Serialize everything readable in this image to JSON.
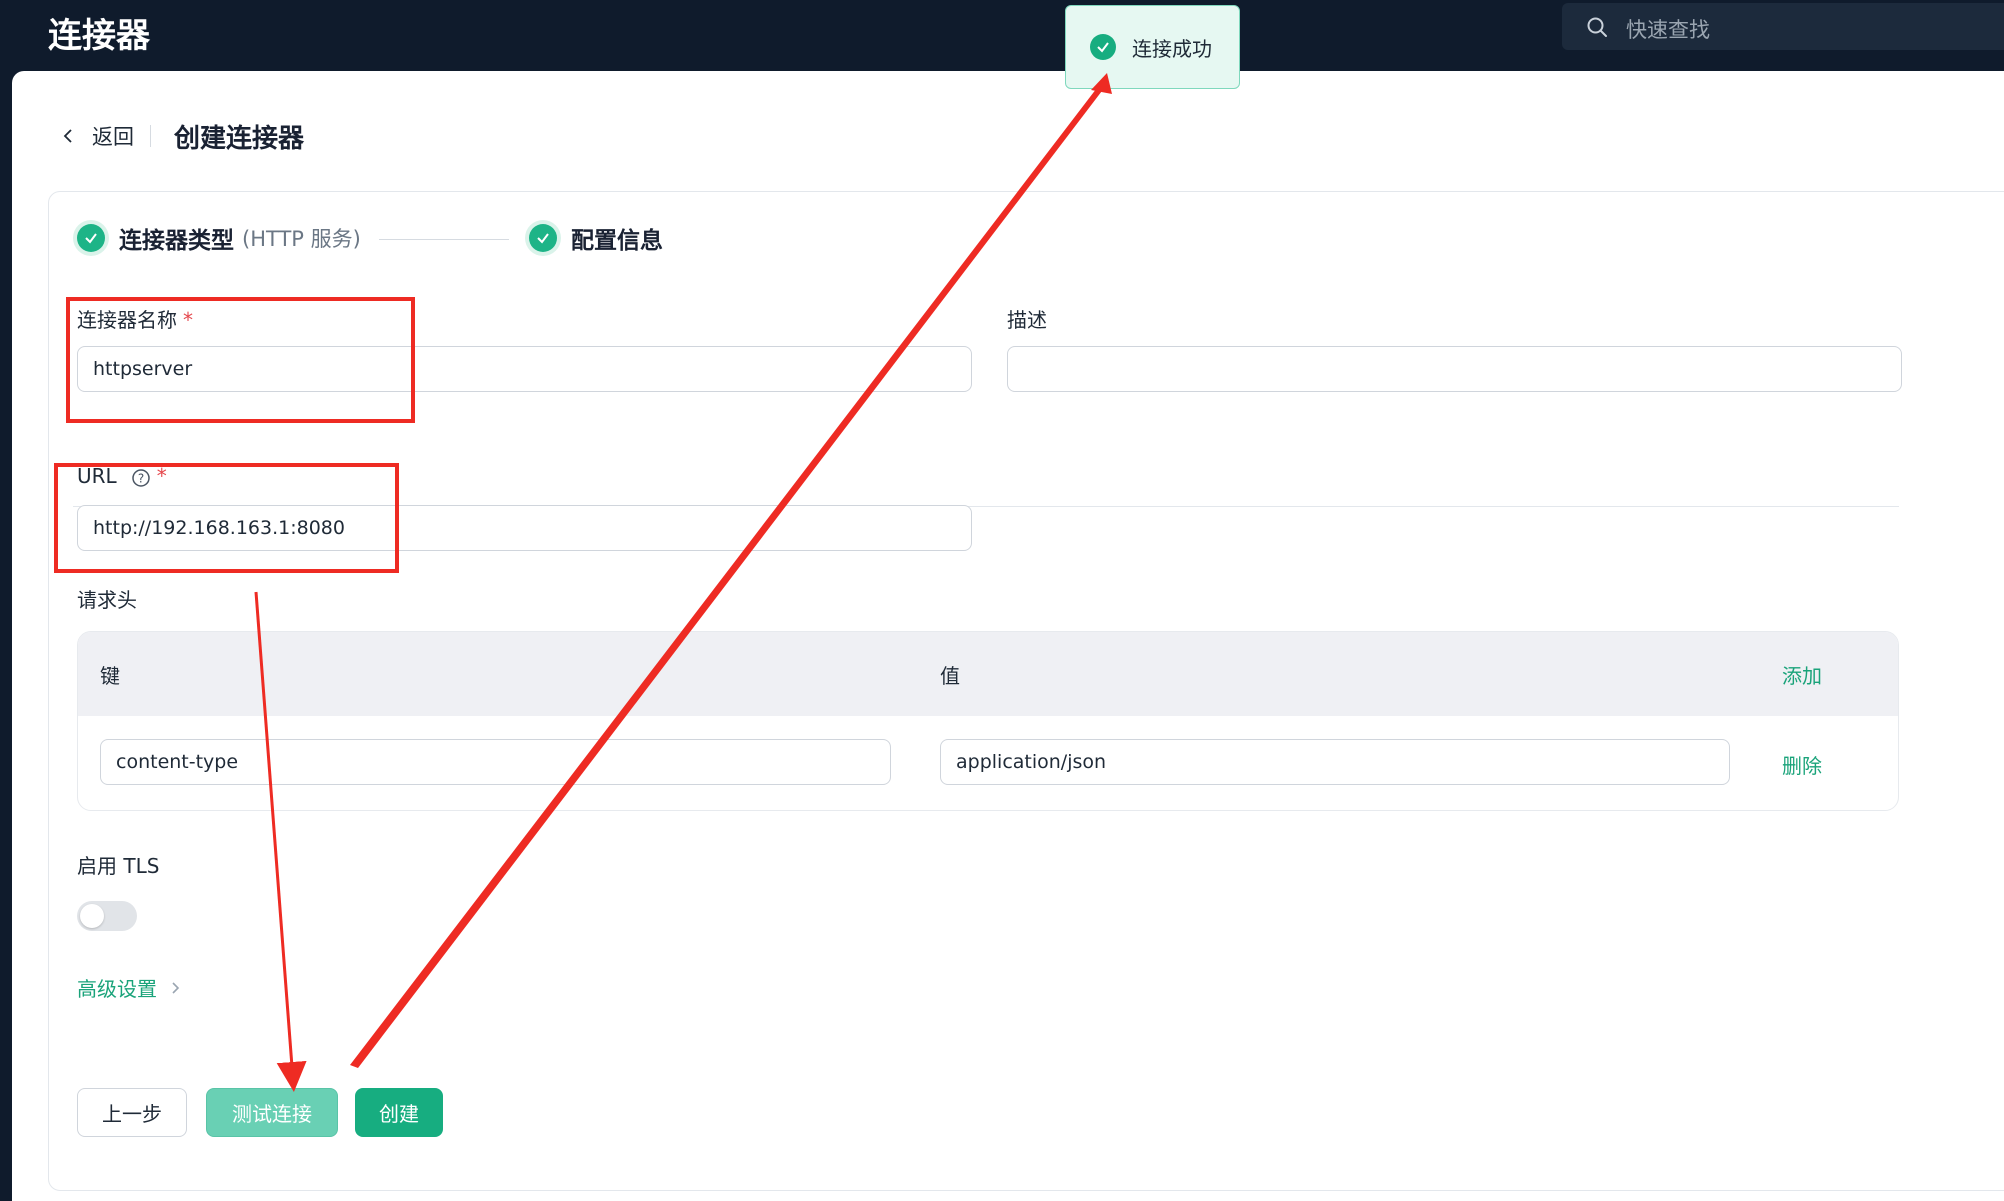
{
  "header": {
    "app_title": "连接器",
    "search_placeholder": "快速查找"
  },
  "page": {
    "back_label": "返回",
    "title": "创建连接器"
  },
  "steps": [
    {
      "label": "连接器类型",
      "sub": "(HTTP 服务)",
      "status": "done"
    },
    {
      "label": "配置信息",
      "status": "done"
    }
  ],
  "form": {
    "name_label": "连接器名称",
    "name_value": "httpserver",
    "required_mark": "*",
    "desc_label": "描述",
    "desc_value": "",
    "url_label": "URL",
    "url_value": "http://192.168.163.1:8080",
    "headers_label": "请求头",
    "headers_table": {
      "key_header": "键",
      "value_header": "值",
      "add_label": "添加",
      "rows": [
        {
          "key": "content-type",
          "value": "application/json",
          "delete_label": "删除"
        }
      ]
    },
    "tls_label": "启用 TLS",
    "tls_enabled": false,
    "advanced_label": "高级设置"
  },
  "buttons": {
    "prev": "上一步",
    "test": "测试连接",
    "create": "创建"
  },
  "toast": {
    "text": "连接成功",
    "type": "success"
  },
  "colors": {
    "accent": "#17ad80",
    "annotation": "#ee2b23",
    "header_bg": "#0f1b2c"
  }
}
